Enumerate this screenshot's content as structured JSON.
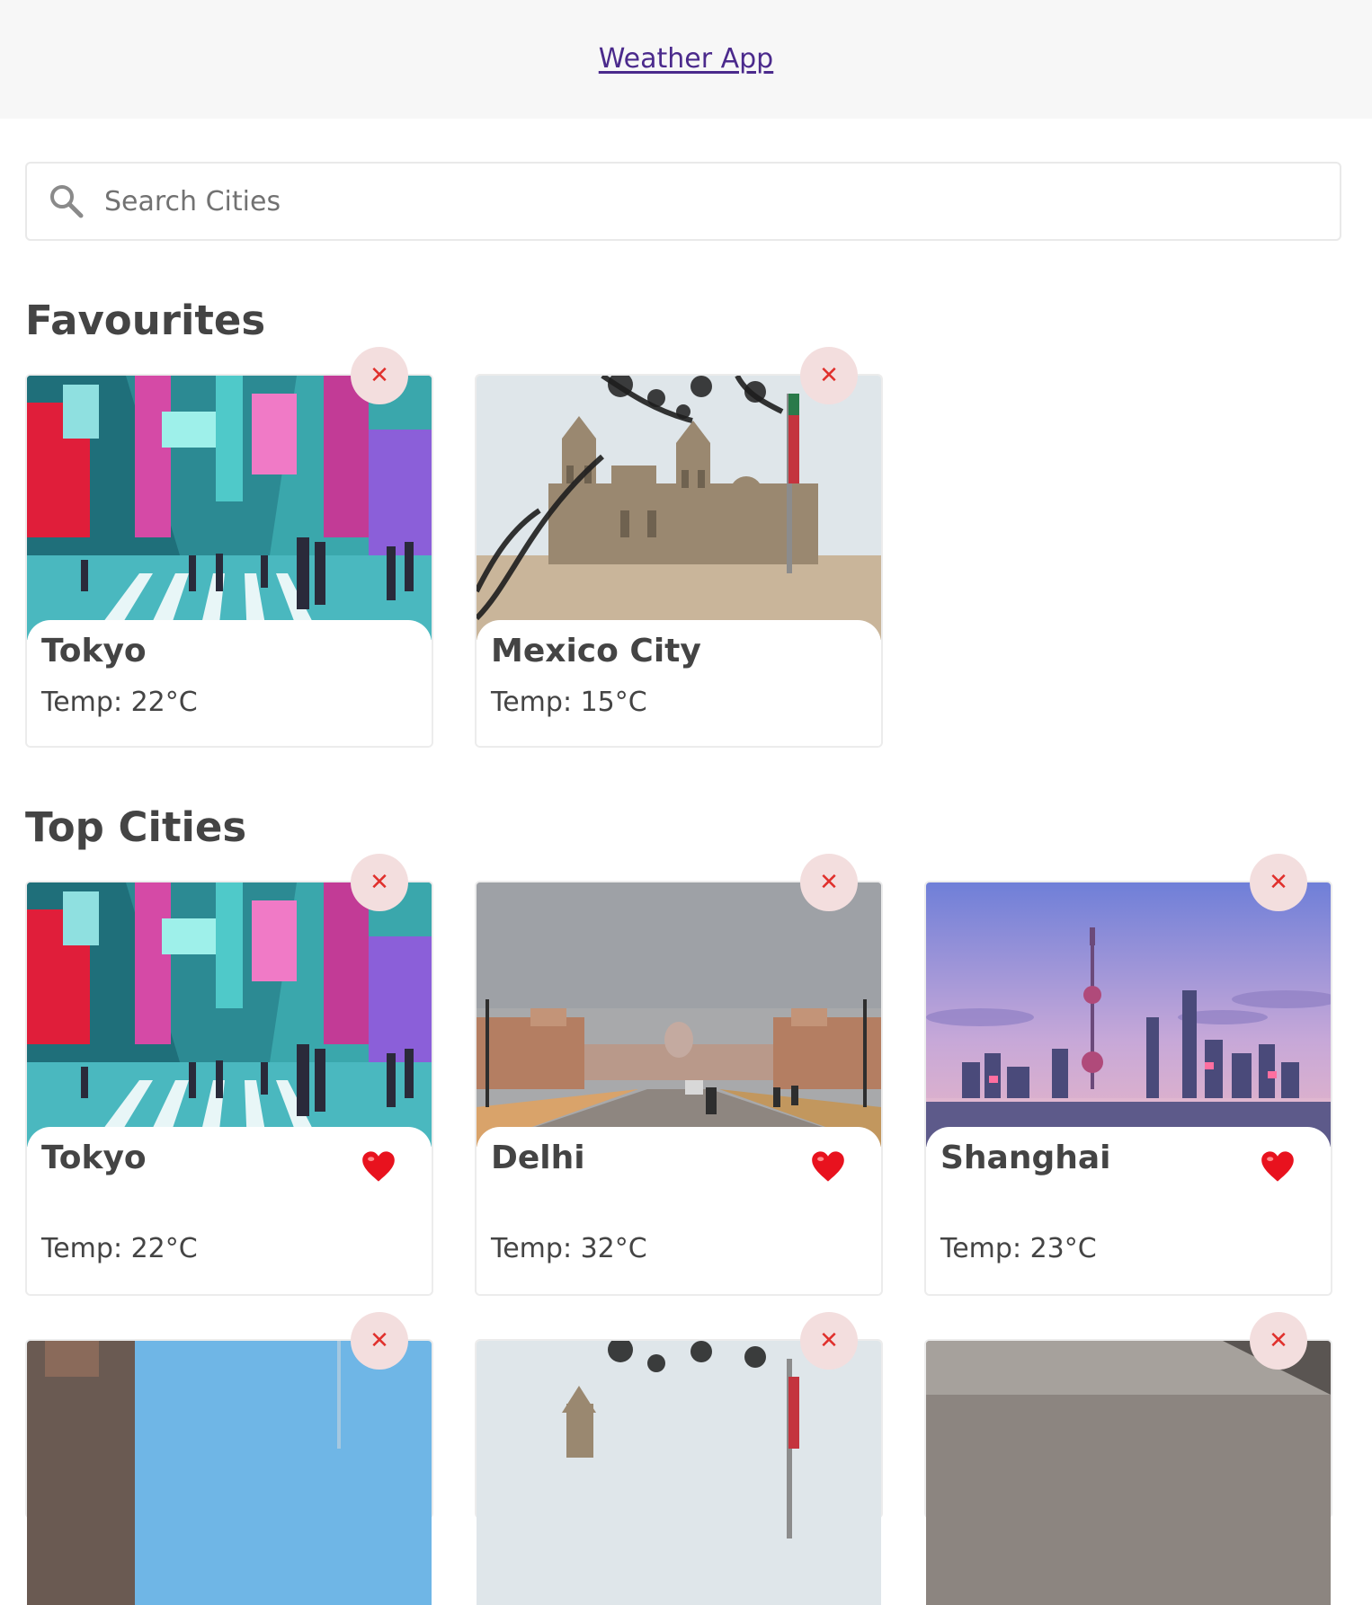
{
  "header": {
    "title": "Weather App"
  },
  "search": {
    "placeholder": "Search Cities",
    "value": ""
  },
  "favourites": {
    "title": "Favourites",
    "cards": [
      {
        "city": "Tokyo",
        "temp": "Temp: 22°C"
      },
      {
        "city": "Mexico City",
        "temp": "Temp: 15°C"
      }
    ]
  },
  "top_cities": {
    "title": "Top Cities",
    "cards": [
      {
        "city": "Tokyo",
        "temp": "Temp: 22°C"
      },
      {
        "city": "Delhi",
        "temp": "Temp: 32°C"
      },
      {
        "city": "Shanghai",
        "temp": "Temp: 23°C"
      }
    ]
  },
  "close_symbol": "✕",
  "colors": {
    "header_bg": "#f7f7f7",
    "link": "#4b2a8c",
    "close_bg": "#f3dede",
    "close_x": "#e0302c",
    "heart": "#e8121e"
  }
}
